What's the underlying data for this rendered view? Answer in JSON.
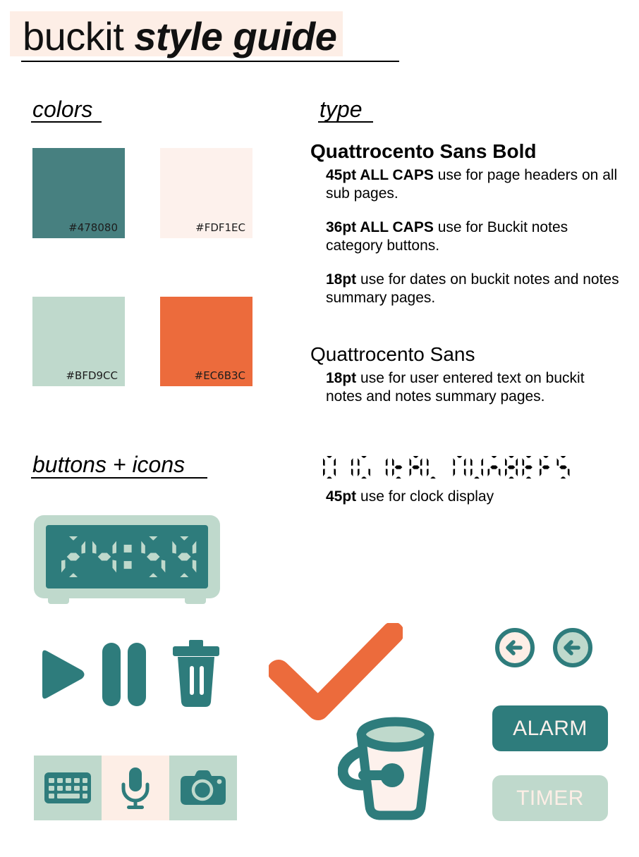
{
  "title": {
    "part1": "buckit",
    "part2": "style guide"
  },
  "sections": {
    "colors": "colors",
    "type": "type",
    "buttons": "buttons + icons"
  },
  "colors": {
    "swatches": [
      {
        "name": "teal",
        "hex": "#478080"
      },
      {
        "name": "cream",
        "hex": "#FDF1EC"
      },
      {
        "name": "mint",
        "hex": "#BFD9CC"
      },
      {
        "name": "orange",
        "hex": "#EC6B3C"
      }
    ]
  },
  "type": {
    "family_bold": "Quattrocento Sans Bold",
    "family_regular": "Quattrocento Sans",
    "digital_family_sample": "DIGITAL NUMBERS",
    "specs_bold": [
      {
        "size": "45pt ALL CAPS",
        "usage": " use for page headers on all sub pages."
      },
      {
        "size": "36pt ALL CAPS",
        "usage": " use for Buckit notes category buttons."
      },
      {
        "size": "18pt",
        "usage": " use for dates on buckit notes and notes summary pages."
      }
    ],
    "specs_regular": [
      {
        "size": "18pt",
        "usage": " use for user entered text on buckit notes and notes summary pages."
      }
    ],
    "specs_digital": [
      {
        "size": "45pt",
        "usage": " use for clock display"
      }
    ]
  },
  "clock": {
    "display": "24:59",
    "hours": "24",
    "minutes": "59",
    "separator": ":"
  },
  "buttons": {
    "alarm_label": "ALARM",
    "timer_label": "TIMER"
  },
  "icons": {
    "play": "play-icon",
    "pause": "pause-icon",
    "trash": "trash-icon",
    "keyboard": "keyboard-icon",
    "microphone": "microphone-icon",
    "camera": "camera-icon",
    "check": "check-icon",
    "bucket": "bucket-logo-icon",
    "back_cream": "back-arrow-icon",
    "back_mint": "back-arrow-icon"
  },
  "palette": {
    "teal": "#478080",
    "teal_deep": "#2E7C7C",
    "cream": "#FDF1EC",
    "cream_pink": "#FDEEE6",
    "mint": "#BFD9CC",
    "orange": "#EC6B3C",
    "ink": "#000000"
  }
}
